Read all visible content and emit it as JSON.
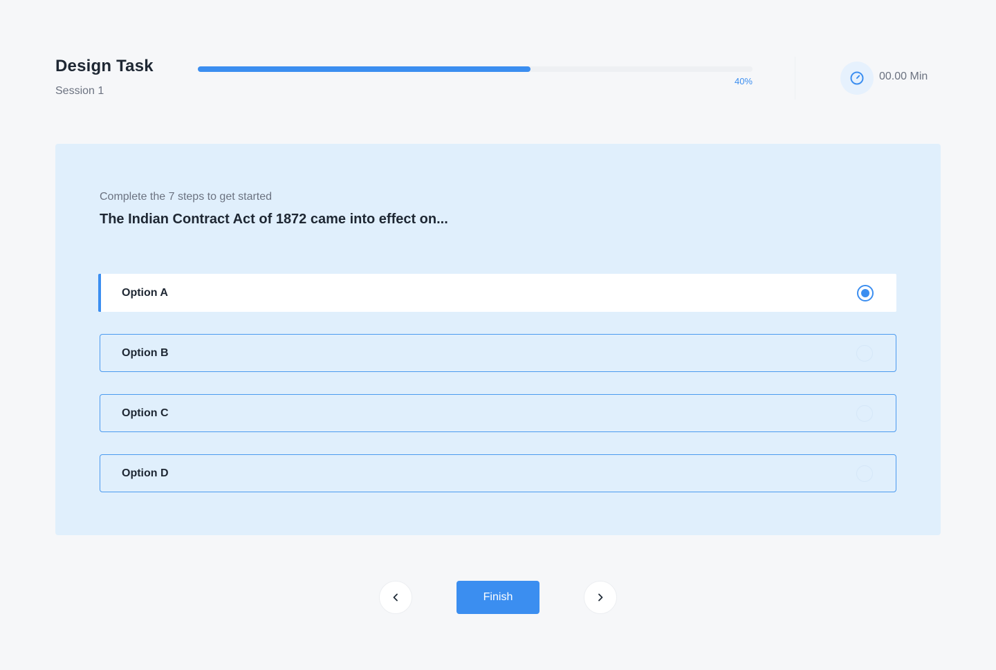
{
  "header": {
    "title": "Design Task",
    "subtitle": "Session 1",
    "progress": {
      "value": 0.4,
      "label": "40%"
    },
    "timer": {
      "icon": "timer-icon",
      "text": "00.00 Min"
    }
  },
  "question_card": {
    "instructions": "Complete the 7 steps to get started",
    "question": "The Indian Contract Act of 1872 came into effect on...",
    "options": [
      {
        "label": "Option A",
        "selected": true
      },
      {
        "label": "Option B",
        "selected": false
      },
      {
        "label": "Option C",
        "selected": false
      },
      {
        "label": "Option D",
        "selected": false
      }
    ]
  },
  "footer": {
    "prev_icon": "chevron-left-icon",
    "finish_label": "Finish",
    "next_icon": "chevron-right-icon"
  },
  "colors": {
    "accent": "#3b8ef0",
    "background": "#f6f7f9",
    "card_background": "#e0effc",
    "text_primary": "#1e2733",
    "text_secondary": "#6b7280"
  }
}
